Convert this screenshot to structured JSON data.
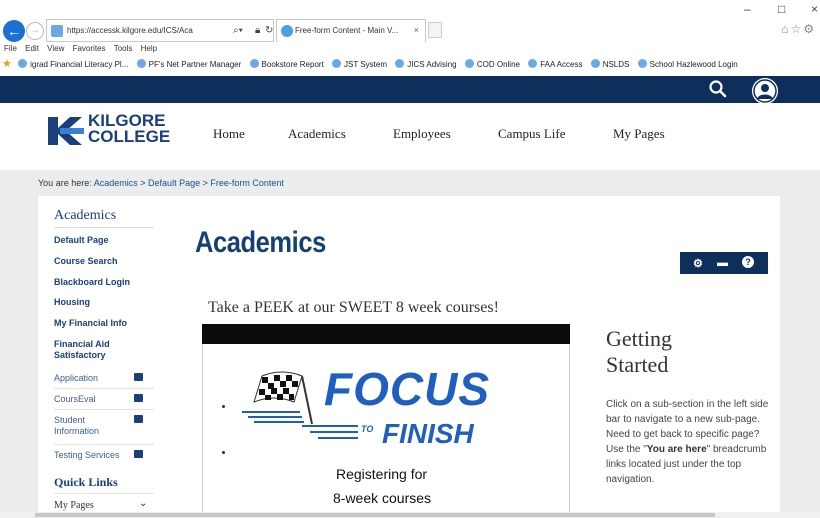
{
  "browser": {
    "url": "https://accessk.kilgore.edu/ICS/Aca",
    "tab_title": "Free-form Content - Main V...",
    "tab_close": "×",
    "window_controls": [
      "–",
      "□",
      "×"
    ],
    "menu": [
      "File",
      "Edit",
      "View",
      "Favorites",
      "Tools",
      "Help"
    ],
    "favorites": [
      "igrad Financial Literacy Pl...",
      "PF's Net Partner Manager",
      "Bookstore Report",
      "JST System",
      "JICS Advising",
      "COD Online",
      "FAA Access",
      "NSLDS",
      "School Hazlewood Login"
    ]
  },
  "site": {
    "logo_line1": "KILGORE",
    "logo_line2": "COLLEGE",
    "nav": [
      "Home",
      "Academics",
      "Employees",
      "Campus Life",
      "My Pages"
    ]
  },
  "breadcrumb": {
    "prefix": "You are here:",
    "items": [
      "Academics",
      "Default Page",
      "Free-form Content"
    ],
    "sep": ">"
  },
  "sidebar": {
    "heading": "Academics",
    "links": [
      "Default Page",
      "Course Search",
      "Blackboard Login",
      "Housing",
      "My Financial Info",
      "Financial Aid Satisfactory"
    ],
    "subsections": [
      "Application",
      "CoursEval",
      "Student Information",
      "Testing Services"
    ],
    "quick_links": "Quick Links",
    "my_pages": "My Pages"
  },
  "main": {
    "title": "Academics",
    "peek": "Take a PEEK at our SWEET 8 week courses!",
    "flyer_focus": "FOCUS",
    "flyer_to": "TO",
    "flyer_finish": "FINISH",
    "flyer_line1": "Registering for",
    "flyer_line2": "8-week courses"
  },
  "getting_started": {
    "heading_line1": "Getting",
    "heading_line2": "Started",
    "p1": "Click on a sub-section in the left side bar to navigate to a new sub-page.",
    "p2a": "Need to get back to specific page? Use the \"",
    "p2b": "You are here",
    "p2c": "\" breadcrumb links located just under the top navigation."
  },
  "colors": {
    "navy": "#0e2f5c",
    "accent_blue": "#1f5fbf",
    "link_blue": "#1a3f7a"
  }
}
